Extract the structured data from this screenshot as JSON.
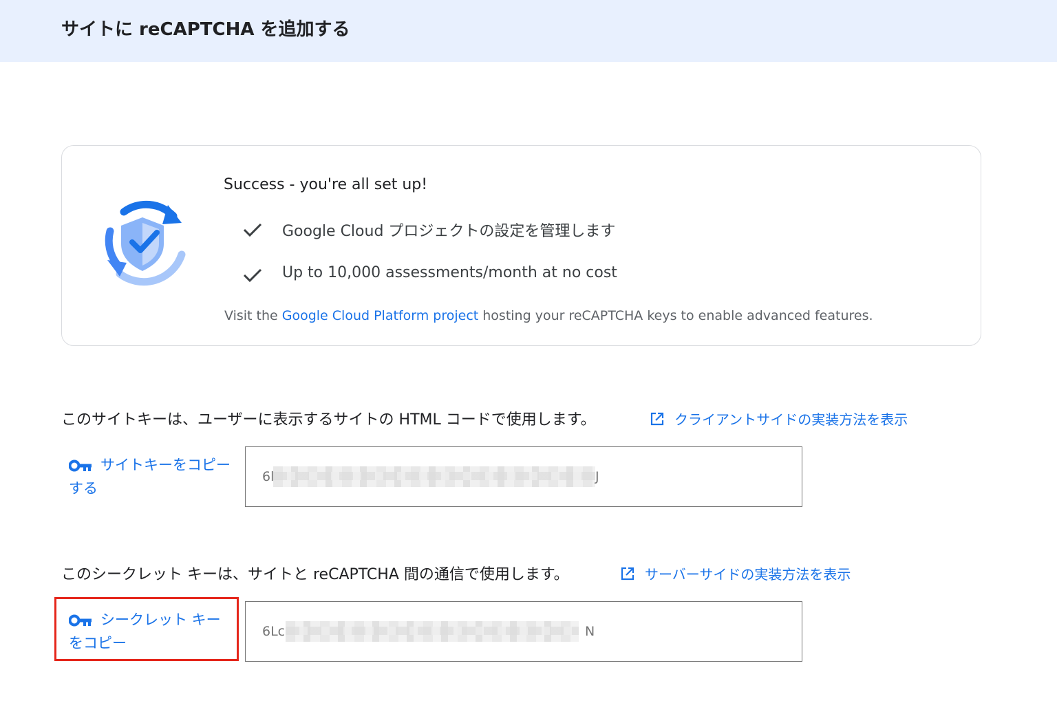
{
  "header": {
    "title": "サイトに reCAPTCHA を追加する"
  },
  "success_card": {
    "title": "Success - you're all set up!",
    "features": [
      "Google Cloud プロジェクトの設定を管理します",
      "Up to 10,000 assessments/month at no cost"
    ],
    "note_prefix": "Visit the ",
    "note_link": "Google Cloud Platform project",
    "note_suffix": " hosting your reCAPTCHA keys to enable advanced features."
  },
  "site_key": {
    "description": "このサイトキーは、ユーザーに表示するサイトの HTML コードで使用します。",
    "link_label": "クライアントサイドの実装方法を表示",
    "copy_label": "サイトキーをコピーする",
    "value_visible_start": "6l",
    "value_visible_end": "J"
  },
  "secret_key": {
    "description": "このシークレット キーは、サイトと reCAPTCHA 間の通信で使用します。",
    "link_label": "サーバーサイドの実装方法を表示",
    "copy_label": "シークレット キーをコピー",
    "value_visible_start": "6Lc",
    "value_visible_end": "N"
  },
  "colors": {
    "header_bg": "#e8f0fe",
    "link": "#1a73e8",
    "highlight": "#e5261b",
    "text": "#202124"
  },
  "icons": {
    "logo": "recaptcha-shield-icon",
    "check": "check-icon",
    "external_link": "open-in-new-icon",
    "key": "key-icon"
  }
}
